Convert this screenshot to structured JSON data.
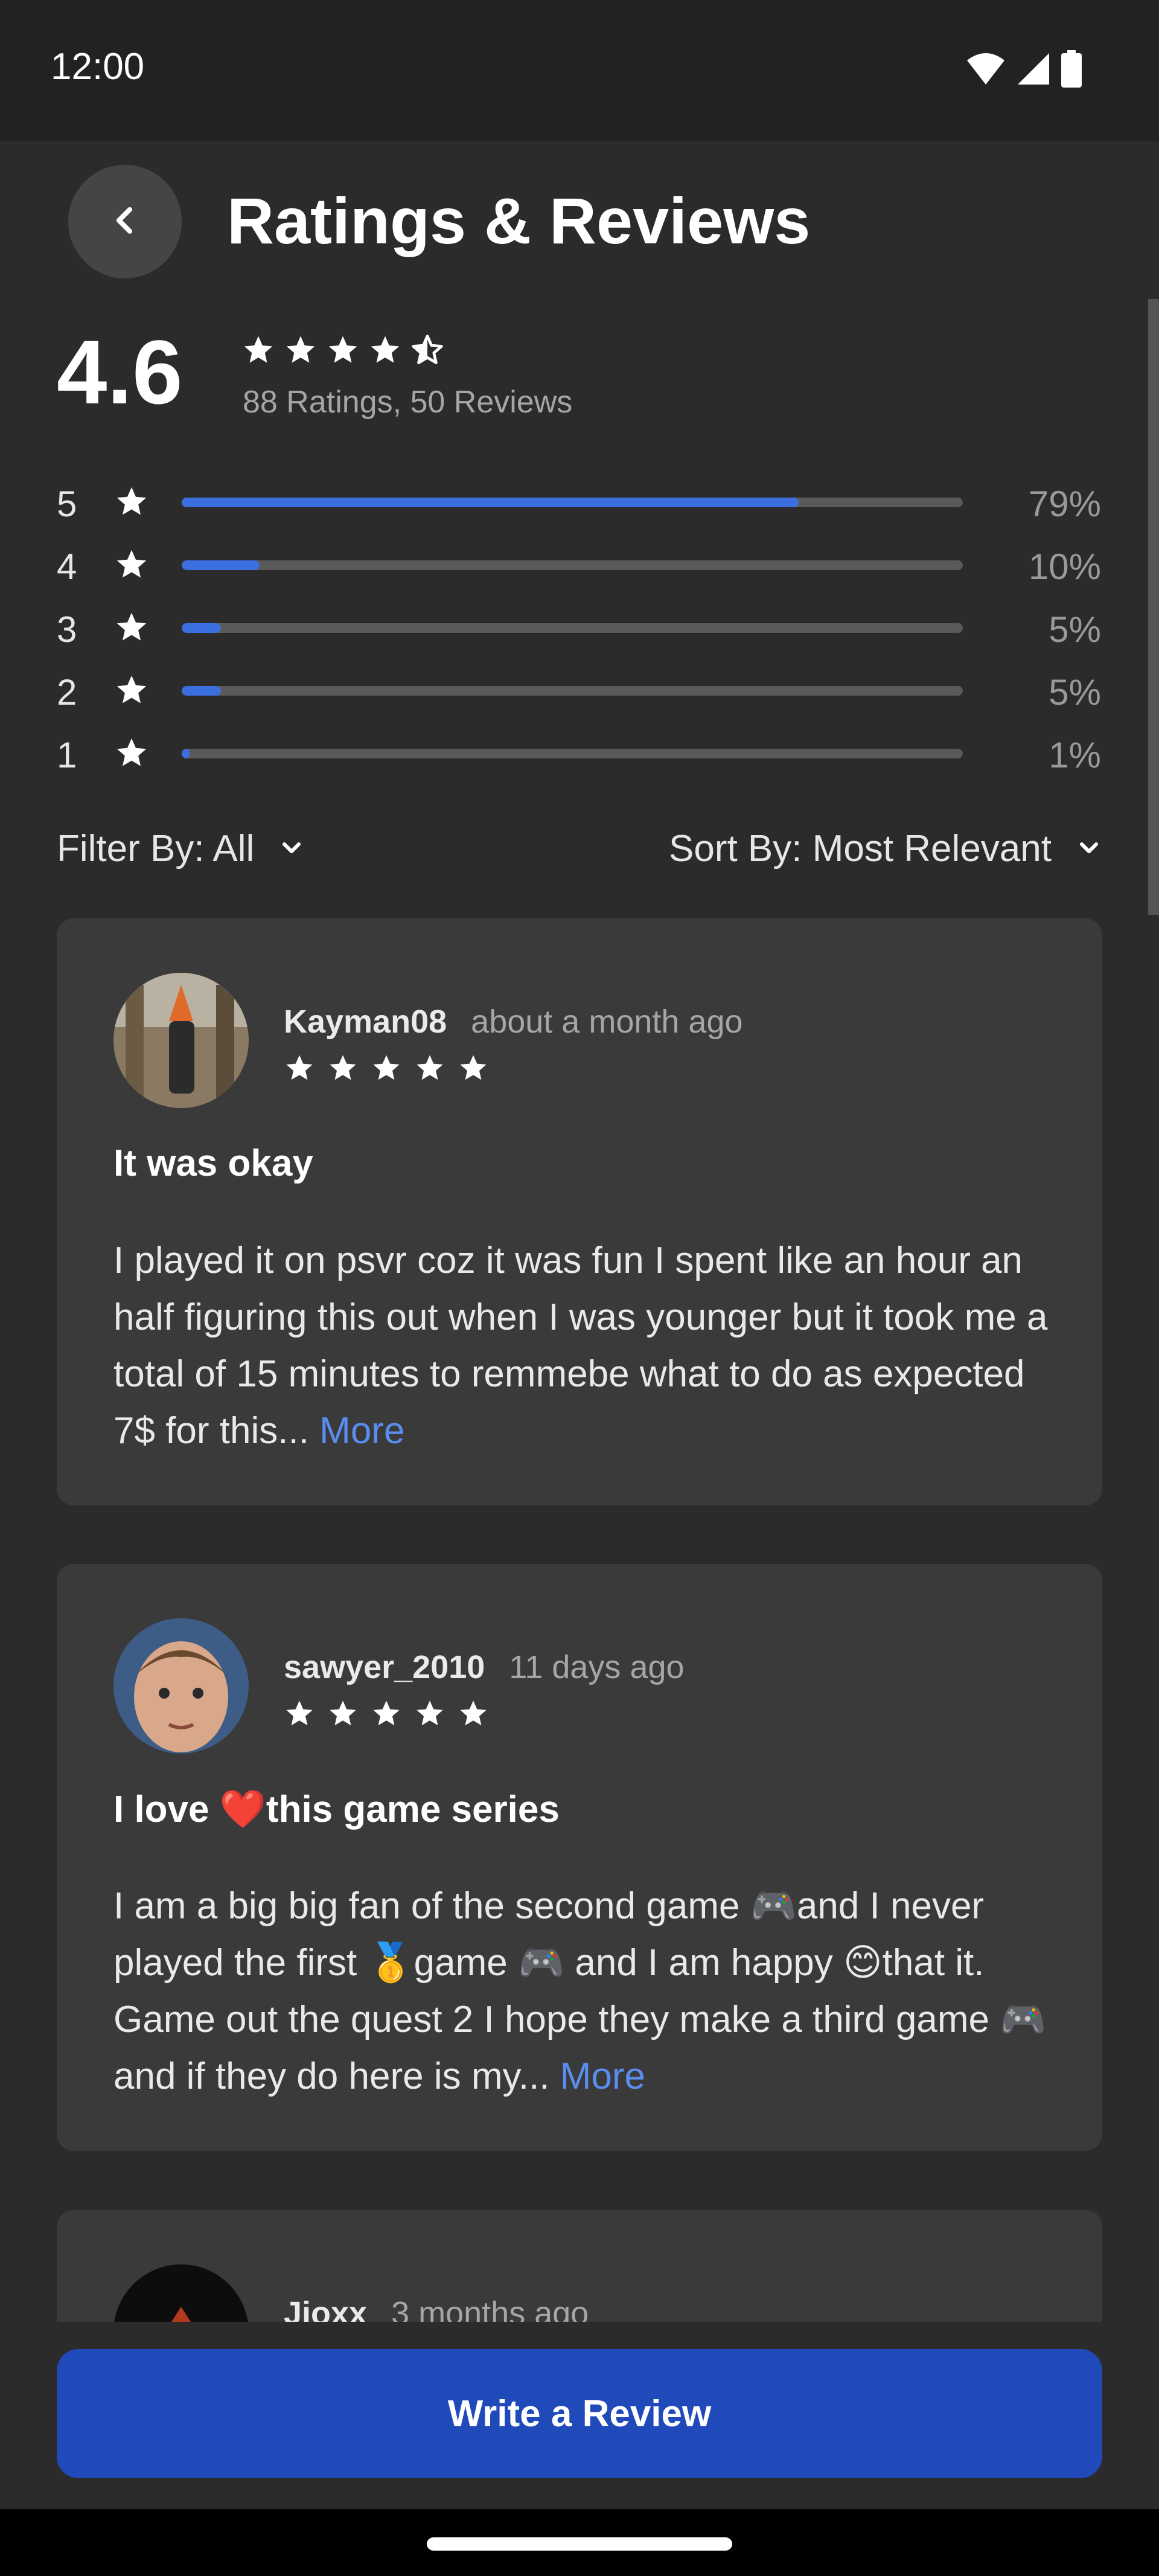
{
  "status_bar": {
    "time": "12:00"
  },
  "header": {
    "title": "Ratings & Reviews"
  },
  "summary": {
    "score": "4.6",
    "rating_stars": 4.5,
    "count_text": "88 Ratings, 50 Reviews"
  },
  "distribution": [
    {
      "stars": "5",
      "percent_label": "79%",
      "fill_percent": 79
    },
    {
      "stars": "4",
      "percent_label": "10%",
      "fill_percent": 10
    },
    {
      "stars": "3",
      "percent_label": "5%",
      "fill_percent": 5
    },
    {
      "stars": "2",
      "percent_label": "5%",
      "fill_percent": 5
    },
    {
      "stars": "1",
      "percent_label": "1%",
      "fill_percent": 1
    }
  ],
  "filters": {
    "filter_label": "Filter By: All",
    "sort_label": "Sort By: Most Relevant"
  },
  "reviews": [
    {
      "name": "Kayman08",
      "time": "about a month ago",
      "stars": 5,
      "title": "It was okay",
      "body": "I played it on psvr coz it was fun I spent like an hour an half figuring this out when I was younger but it took me a total of 15 minutes to remmebe what to do as expected 7$ for this...",
      "more": "More"
    },
    {
      "name": "sawyer_2010",
      "time": "11 days ago",
      "stars": 5,
      "title": "I love ❤️this game series",
      "body": "I am a big big fan of the second game 🎮and I never played the first 🥇game 🎮 and I am happy 😊that it. Game out the quest 2 I hope they make a third game 🎮 and if they do here is my...",
      "more": "More"
    },
    {
      "name": "Jioxx",
      "time": "3 months ago"
    }
  ],
  "cta": {
    "label": "Write a Review"
  },
  "colors": {
    "accent": "#2049ba",
    "bar_fill": "#3b6fe0",
    "link": "#5b8df0",
    "background": "#2b2b2b",
    "card": "#3a3a3a"
  }
}
